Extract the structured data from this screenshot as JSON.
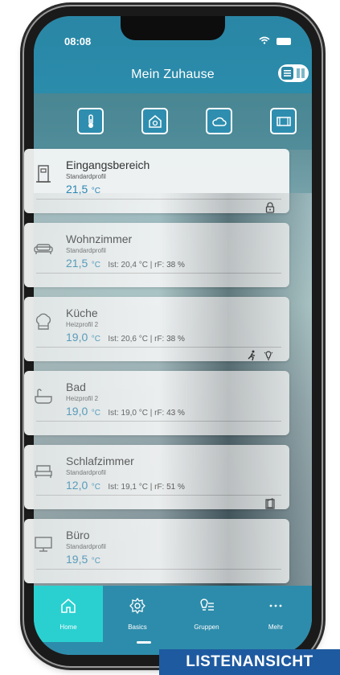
{
  "status": {
    "time": "08:08"
  },
  "header": {
    "title": "Mein Zuhause"
  },
  "icons": {
    "top": [
      "thermometer-icon",
      "house-icon",
      "cloud-icon",
      "window-icon"
    ]
  },
  "rooms": [
    {
      "name": "Eingangsbereich",
      "profile": "Standardprofil",
      "temp": "21,5",
      "unit": "°C",
      "ist": "",
      "indicators": [
        "lock-icon"
      ]
    },
    {
      "name": "Wohnzimmer",
      "profile": "Standardprofil",
      "temp": "21,5",
      "unit": "°C",
      "ist": "Ist: 20,4 °C | rF: 38 %",
      "indicators": []
    },
    {
      "name": "Küche",
      "profile": "Heizprofil 2",
      "temp": "19,0",
      "unit": "°C",
      "ist": "Ist: 20,6 °C | rF: 38 %",
      "indicators": [
        "motion-icon",
        "light-icon"
      ]
    },
    {
      "name": "Bad",
      "profile": "Heizprofil 2",
      "temp": "19,0",
      "unit": "°C",
      "ist": "Ist: 19,0 °C | rF: 43 %",
      "indicators": []
    },
    {
      "name": "Schlafzimmer",
      "profile": "Standardprofil",
      "temp": "12,0",
      "unit": "°C",
      "ist": "Ist: 19,1 °C | rF: 51 %",
      "indicators": [
        "window-open-icon"
      ]
    },
    {
      "name": "Büro",
      "profile": "Standardprofil",
      "temp": "19,5",
      "unit": "°C",
      "ist": "",
      "indicators": []
    }
  ],
  "tabs": [
    {
      "label": "Home",
      "icon": "home-icon",
      "active": true
    },
    {
      "label": "Basics",
      "icon": "gear-icon",
      "active": false
    },
    {
      "label": "Gruppen",
      "icon": "groups-icon",
      "active": false
    },
    {
      "label": "Mehr",
      "icon": "more-icon",
      "active": false
    }
  ],
  "caption": "LISTENANSICHT",
  "colors": {
    "header": "#2a86a5",
    "tabbar": "#2d8cab",
    "active_tab": "#2ad0d0",
    "temp": "#2a86b3",
    "caption": "#1e5aa0"
  }
}
